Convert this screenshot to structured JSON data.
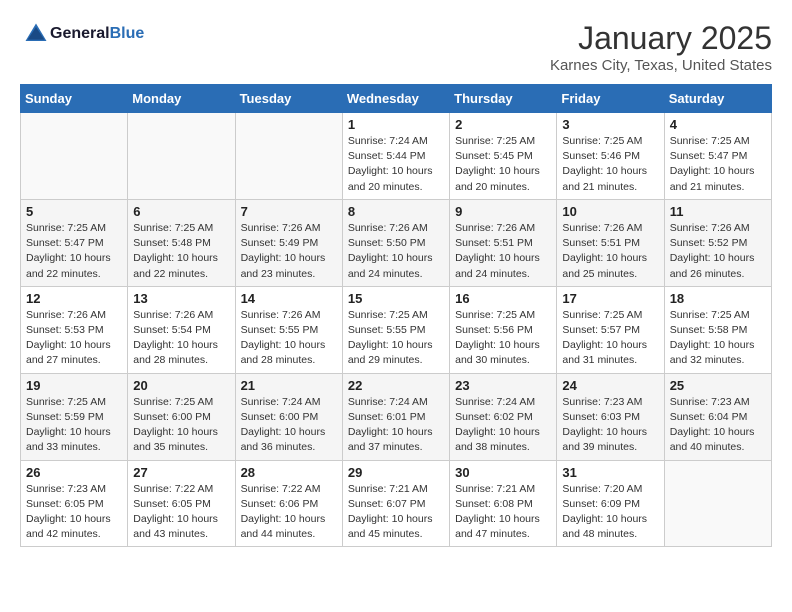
{
  "header": {
    "logo_general": "General",
    "logo_blue": "Blue",
    "month": "January 2025",
    "location": "Karnes City, Texas, United States"
  },
  "weekdays": [
    "Sunday",
    "Monday",
    "Tuesday",
    "Wednesday",
    "Thursday",
    "Friday",
    "Saturday"
  ],
  "weeks": [
    [
      {
        "day": "",
        "sunrise": "",
        "sunset": "",
        "daylight": ""
      },
      {
        "day": "",
        "sunrise": "",
        "sunset": "",
        "daylight": ""
      },
      {
        "day": "",
        "sunrise": "",
        "sunset": "",
        "daylight": ""
      },
      {
        "day": "1",
        "sunrise": "Sunrise: 7:24 AM",
        "sunset": "Sunset: 5:44 PM",
        "daylight": "Daylight: 10 hours and 20 minutes."
      },
      {
        "day": "2",
        "sunrise": "Sunrise: 7:25 AM",
        "sunset": "Sunset: 5:45 PM",
        "daylight": "Daylight: 10 hours and 20 minutes."
      },
      {
        "day": "3",
        "sunrise": "Sunrise: 7:25 AM",
        "sunset": "Sunset: 5:46 PM",
        "daylight": "Daylight: 10 hours and 21 minutes."
      },
      {
        "day": "4",
        "sunrise": "Sunrise: 7:25 AM",
        "sunset": "Sunset: 5:47 PM",
        "daylight": "Daylight: 10 hours and 21 minutes."
      }
    ],
    [
      {
        "day": "5",
        "sunrise": "Sunrise: 7:25 AM",
        "sunset": "Sunset: 5:47 PM",
        "daylight": "Daylight: 10 hours and 22 minutes."
      },
      {
        "day": "6",
        "sunrise": "Sunrise: 7:25 AM",
        "sunset": "Sunset: 5:48 PM",
        "daylight": "Daylight: 10 hours and 22 minutes."
      },
      {
        "day": "7",
        "sunrise": "Sunrise: 7:26 AM",
        "sunset": "Sunset: 5:49 PM",
        "daylight": "Daylight: 10 hours and 23 minutes."
      },
      {
        "day": "8",
        "sunrise": "Sunrise: 7:26 AM",
        "sunset": "Sunset: 5:50 PM",
        "daylight": "Daylight: 10 hours and 24 minutes."
      },
      {
        "day": "9",
        "sunrise": "Sunrise: 7:26 AM",
        "sunset": "Sunset: 5:51 PM",
        "daylight": "Daylight: 10 hours and 24 minutes."
      },
      {
        "day": "10",
        "sunrise": "Sunrise: 7:26 AM",
        "sunset": "Sunset: 5:51 PM",
        "daylight": "Daylight: 10 hours and 25 minutes."
      },
      {
        "day": "11",
        "sunrise": "Sunrise: 7:26 AM",
        "sunset": "Sunset: 5:52 PM",
        "daylight": "Daylight: 10 hours and 26 minutes."
      }
    ],
    [
      {
        "day": "12",
        "sunrise": "Sunrise: 7:26 AM",
        "sunset": "Sunset: 5:53 PM",
        "daylight": "Daylight: 10 hours and 27 minutes."
      },
      {
        "day": "13",
        "sunrise": "Sunrise: 7:26 AM",
        "sunset": "Sunset: 5:54 PM",
        "daylight": "Daylight: 10 hours and 28 minutes."
      },
      {
        "day": "14",
        "sunrise": "Sunrise: 7:26 AM",
        "sunset": "Sunset: 5:55 PM",
        "daylight": "Daylight: 10 hours and 28 minutes."
      },
      {
        "day": "15",
        "sunrise": "Sunrise: 7:25 AM",
        "sunset": "Sunset: 5:55 PM",
        "daylight": "Daylight: 10 hours and 29 minutes."
      },
      {
        "day": "16",
        "sunrise": "Sunrise: 7:25 AM",
        "sunset": "Sunset: 5:56 PM",
        "daylight": "Daylight: 10 hours and 30 minutes."
      },
      {
        "day": "17",
        "sunrise": "Sunrise: 7:25 AM",
        "sunset": "Sunset: 5:57 PM",
        "daylight": "Daylight: 10 hours and 31 minutes."
      },
      {
        "day": "18",
        "sunrise": "Sunrise: 7:25 AM",
        "sunset": "Sunset: 5:58 PM",
        "daylight": "Daylight: 10 hours and 32 minutes."
      }
    ],
    [
      {
        "day": "19",
        "sunrise": "Sunrise: 7:25 AM",
        "sunset": "Sunset: 5:59 PM",
        "daylight": "Daylight: 10 hours and 33 minutes."
      },
      {
        "day": "20",
        "sunrise": "Sunrise: 7:25 AM",
        "sunset": "Sunset: 6:00 PM",
        "daylight": "Daylight: 10 hours and 35 minutes."
      },
      {
        "day": "21",
        "sunrise": "Sunrise: 7:24 AM",
        "sunset": "Sunset: 6:00 PM",
        "daylight": "Daylight: 10 hours and 36 minutes."
      },
      {
        "day": "22",
        "sunrise": "Sunrise: 7:24 AM",
        "sunset": "Sunset: 6:01 PM",
        "daylight": "Daylight: 10 hours and 37 minutes."
      },
      {
        "day": "23",
        "sunrise": "Sunrise: 7:24 AM",
        "sunset": "Sunset: 6:02 PM",
        "daylight": "Daylight: 10 hours and 38 minutes."
      },
      {
        "day": "24",
        "sunrise": "Sunrise: 7:23 AM",
        "sunset": "Sunset: 6:03 PM",
        "daylight": "Daylight: 10 hours and 39 minutes."
      },
      {
        "day": "25",
        "sunrise": "Sunrise: 7:23 AM",
        "sunset": "Sunset: 6:04 PM",
        "daylight": "Daylight: 10 hours and 40 minutes."
      }
    ],
    [
      {
        "day": "26",
        "sunrise": "Sunrise: 7:23 AM",
        "sunset": "Sunset: 6:05 PM",
        "daylight": "Daylight: 10 hours and 42 minutes."
      },
      {
        "day": "27",
        "sunrise": "Sunrise: 7:22 AM",
        "sunset": "Sunset: 6:05 PM",
        "daylight": "Daylight: 10 hours and 43 minutes."
      },
      {
        "day": "28",
        "sunrise": "Sunrise: 7:22 AM",
        "sunset": "Sunset: 6:06 PM",
        "daylight": "Daylight: 10 hours and 44 minutes."
      },
      {
        "day": "29",
        "sunrise": "Sunrise: 7:21 AM",
        "sunset": "Sunset: 6:07 PM",
        "daylight": "Daylight: 10 hours and 45 minutes."
      },
      {
        "day": "30",
        "sunrise": "Sunrise: 7:21 AM",
        "sunset": "Sunset: 6:08 PM",
        "daylight": "Daylight: 10 hours and 47 minutes."
      },
      {
        "day": "31",
        "sunrise": "Sunrise: 7:20 AM",
        "sunset": "Sunset: 6:09 PM",
        "daylight": "Daylight: 10 hours and 48 minutes."
      },
      {
        "day": "",
        "sunrise": "",
        "sunset": "",
        "daylight": ""
      }
    ]
  ]
}
